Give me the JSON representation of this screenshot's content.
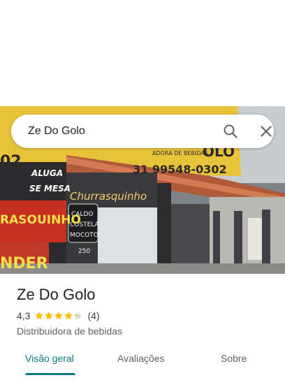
{
  "search": {
    "query": "Ze Do Golo"
  },
  "photo": {
    "sign_phone": "31 99548-0302",
    "sign_brand": "Churrasquinho",
    "sign_small": "ADORA DE BEBIDAS",
    "sign_aluga": "ALUGA",
    "sign_semesa": "SE MESA",
    "sign_menu_1": "CALDO",
    "sign_menu_2": "COSTELA",
    "sign_menu_3": "MOCOTO",
    "sign_price": "250",
    "sign_left": "RASOUINHO",
    "sign_left_2": "NDER",
    "sign_top": "02",
    "sign_olo": "OLO"
  },
  "place": {
    "name": "Ze Do Golo",
    "rating": "4,3",
    "stars": 4.3,
    "review_count": "(4)",
    "category": "Distribuidora de bebidas"
  },
  "tabs": [
    {
      "label": "Visão geral",
      "active": true
    },
    {
      "label": "Avaliações",
      "active": false
    },
    {
      "label": "Sobre",
      "active": false
    }
  ],
  "colors": {
    "accent": "#0b7a83",
    "star": "#fbbc04"
  }
}
